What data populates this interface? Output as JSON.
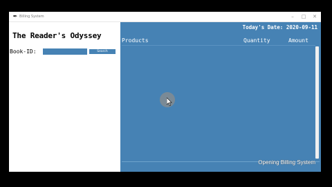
{
  "window": {
    "title": "Billing System",
    "app_icon": "feather-icon",
    "controls": {
      "minimize": "–",
      "maximize": "□",
      "close": "✕"
    }
  },
  "store": {
    "title": "The Reader's Odyssey"
  },
  "search": {
    "label": "Book-ID:",
    "input_value": "",
    "button_label": "Search"
  },
  "header": {
    "date_label": "Today's Date: 2020-09-11"
  },
  "table": {
    "columns": [
      "Products",
      "Quantity",
      "Amount"
    ],
    "rows": []
  },
  "status": {
    "text": "Opening Billing System"
  },
  "colors": {
    "panel": "#4682b4",
    "background": "#000000"
  }
}
